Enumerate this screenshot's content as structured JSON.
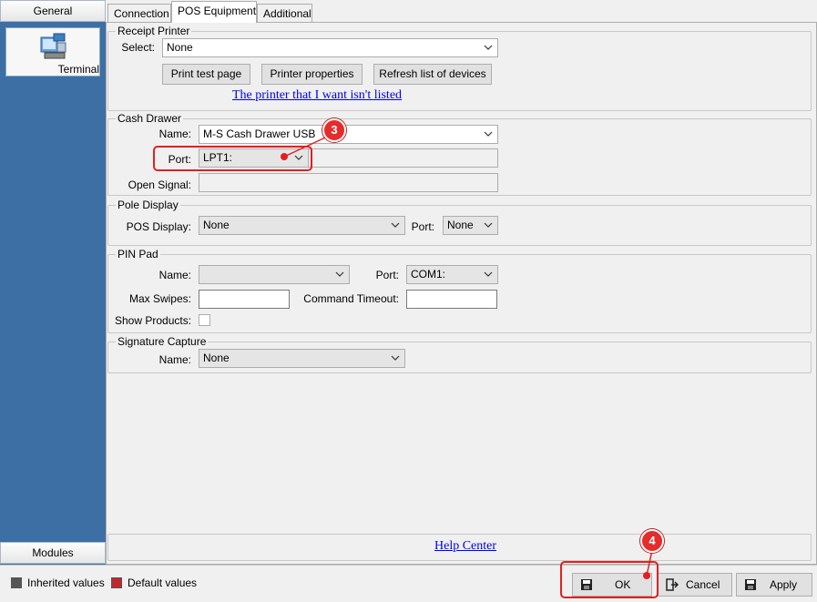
{
  "sidebar": {
    "top_button": "General",
    "terminal_label": "Terminal",
    "bottom_button": "Modules"
  },
  "tabs": [
    {
      "label": "Connection"
    },
    {
      "label": "POS Equipment"
    },
    {
      "label": "Additional"
    }
  ],
  "receipt_printer": {
    "title": "Receipt Printer",
    "select_label": "Select:",
    "select_value": "None",
    "print_test_button": "Print test page",
    "printer_properties_button": "Printer properties",
    "refresh_button": "Refresh list of devices",
    "not_listed_link": "The printer that I want isn't listed"
  },
  "cash_drawer": {
    "title": "Cash Drawer",
    "name_label": "Name:",
    "name_value": "M-S Cash Drawer USB",
    "port_label": "Port:",
    "port_value": "LPT1:",
    "open_signal_label": "Open Signal:"
  },
  "pole_display": {
    "title": "Pole Display",
    "pos_display_label": "POS Display:",
    "pos_display_value": "None",
    "port_label": "Port:",
    "port_value": "None"
  },
  "pin_pad": {
    "title": "PIN Pad",
    "name_label": "Name:",
    "name_value": "",
    "port_label": "Port:",
    "port_value": "COM1:",
    "max_swipes_label": "Max Swipes:",
    "command_timeout_label": "Command Timeout:",
    "show_products_label": "Show Products:"
  },
  "signature_capture": {
    "title": "Signature Capture",
    "name_label": "Name:",
    "name_value": "None"
  },
  "help_center_link": "Help Center",
  "legend": {
    "inherited": "Inherited values",
    "default": "Default values",
    "inherited_color": "#555555",
    "default_color": "#c0282d"
  },
  "dialog_buttons": {
    "ok": "OK",
    "cancel": "Cancel",
    "apply": "Apply"
  },
  "annotations": {
    "step3": "3",
    "step4": "4",
    "color": "#e52c2c"
  }
}
